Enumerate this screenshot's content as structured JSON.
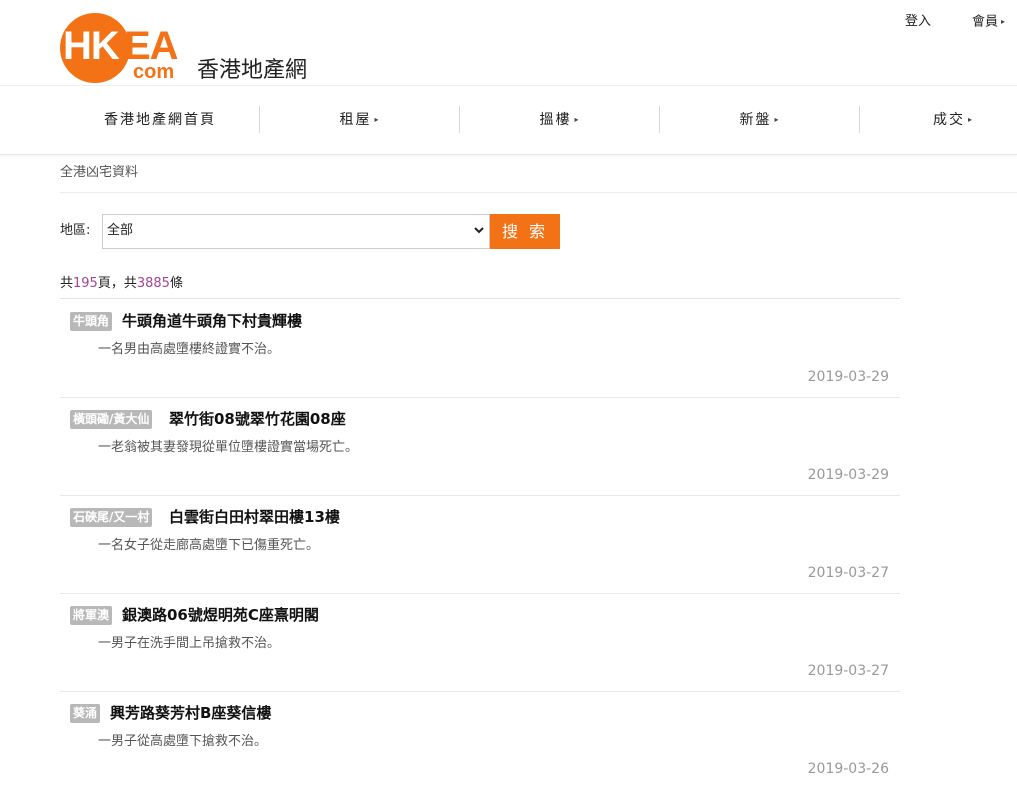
{
  "header": {
    "logo": {
      "hk": "HK",
      "ea": "EA",
      "com": "com"
    },
    "site_name": "香港地產網",
    "login": "登入",
    "member": "會員"
  },
  "nav": {
    "items": [
      {
        "label": "香港地產網首頁",
        "has_caret": false
      },
      {
        "label": "租屋",
        "has_caret": true
      },
      {
        "label": "搵樓",
        "has_caret": true
      },
      {
        "label": "新盤",
        "has_caret": true
      },
      {
        "label": "成交",
        "has_caret": true
      }
    ]
  },
  "breadcrumb": "全港凶宅資料",
  "search": {
    "region_label": "地區:",
    "region_value": "全部",
    "button_label": "搜 索"
  },
  "counts": {
    "prefix": "共",
    "pages": "195",
    "mid": "頁，共",
    "total": "3885",
    "suffix": "條"
  },
  "listings": [
    {
      "tag": "牛頭角",
      "title": "牛頭角道牛頭角下村貴輝樓",
      "desc": "一名男由高處墮樓終證實不治。",
      "date": "2019-03-29"
    },
    {
      "tag": "橫頭磡/黃大仙",
      "title": "翠竹街08號翠竹花園08座",
      "desc": "一老翁被其妻發現從單位墮樓證實當場死亡。",
      "date": "2019-03-29"
    },
    {
      "tag": "石硤尾/又一村",
      "title": "白雲街白田村翠田樓13樓",
      "desc": "一名女子從走廊高處墮下已傷重死亡。",
      "date": "2019-03-27"
    },
    {
      "tag": "將軍澳",
      "title": "銀澳路06號煜明苑C座熹明閣",
      "desc": "一男子在洗手間上吊搶救不治。",
      "date": "2019-03-27"
    },
    {
      "tag": "葵涌",
      "title": "興芳路葵芳村B座葵信樓",
      "desc": "一男子從高處墮下搶救不治。",
      "date": "2019-03-26"
    }
  ],
  "colors": {
    "brand": "#f47216",
    "count_number": "#a8448f",
    "tag_bg": "#b8b8b8"
  },
  "icons": {
    "caret": "caret-right-icon",
    "select": "chevron-down-icon"
  }
}
